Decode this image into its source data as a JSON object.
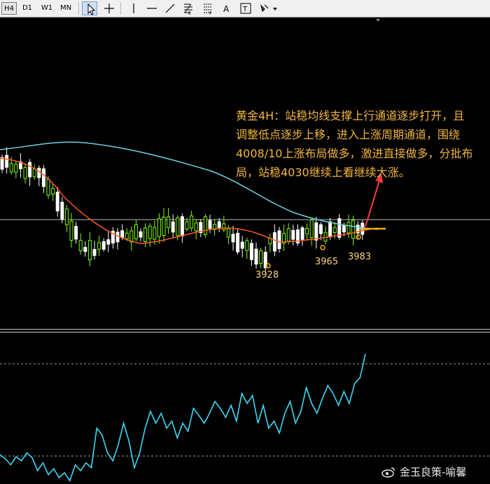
{
  "toolbar": {
    "timeframes": [
      "H4",
      "D1",
      "W1",
      "MN"
    ],
    "active_timeframe": "H4",
    "tools": [
      "cursor-tool",
      "crosshair-tool",
      "vertical-line-tool",
      "horizontal-line-tool",
      "trendline-tool",
      "fibonacci-channel-tool",
      "fibonacci-retracement-tool",
      "text-tool",
      "text-label-tool",
      "shapes-tool"
    ],
    "tool_glyphs": {
      "text": "A",
      "label": "T"
    }
  },
  "annotation": {
    "text": "黄金4H：站稳均线支撑上行通道逐步打开，且调整低点逐步上移，进入上涨周期通道，围绕4008/10上涨布局做多，激进直接做多，分批布局，站稳4030继续上看继续大涨。"
  },
  "levels": {
    "low1": "3928",
    "low2": "3965",
    "low3": "3983"
  },
  "watermark": {
    "text": "金玉良策-喻馨"
  },
  "colors": {
    "bull_candle": "#7CFC00",
    "bear_candle": "#ffffff",
    "ma_slow": "#6fd3e0",
    "ma_fast": "#ff5a1e",
    "indicator": "#3fd7f5",
    "annotation": "#f2b63c",
    "marker": "#f5b100"
  },
  "chart_data": {
    "type": "candlestick",
    "title": "",
    "instrument": "黄金",
    "timeframe": "H4",
    "low_labels": [
      3928,
      3965,
      3983
    ],
    "indicator_series": [
      0.28,
      0.24,
      0.18,
      0.26,
      0.22,
      0.3,
      0.25,
      0.12,
      0.2,
      0.08,
      0.14,
      0.05,
      0.1,
      0.02,
      0.18,
      0.12,
      0.2,
      0.15,
      0.55,
      0.48,
      0.3,
      0.22,
      0.38,
      0.6,
      0.42,
      0.15,
      0.3,
      0.55,
      0.72,
      0.6,
      0.7,
      0.55,
      0.62,
      0.45,
      0.6,
      0.52,
      0.75,
      0.68,
      0.6,
      0.7,
      0.82,
      0.75,
      0.66,
      0.78,
      0.62,
      0.9,
      0.8,
      0.88,
      0.6,
      0.78,
      0.55,
      0.62,
      0.5,
      0.7,
      0.82,
      0.6,
      0.72,
      0.96,
      0.8,
      0.7,
      0.85,
      0.98,
      0.9,
      0.78,
      0.92,
      0.8,
      1.0,
      1.06,
      1.3
    ]
  }
}
